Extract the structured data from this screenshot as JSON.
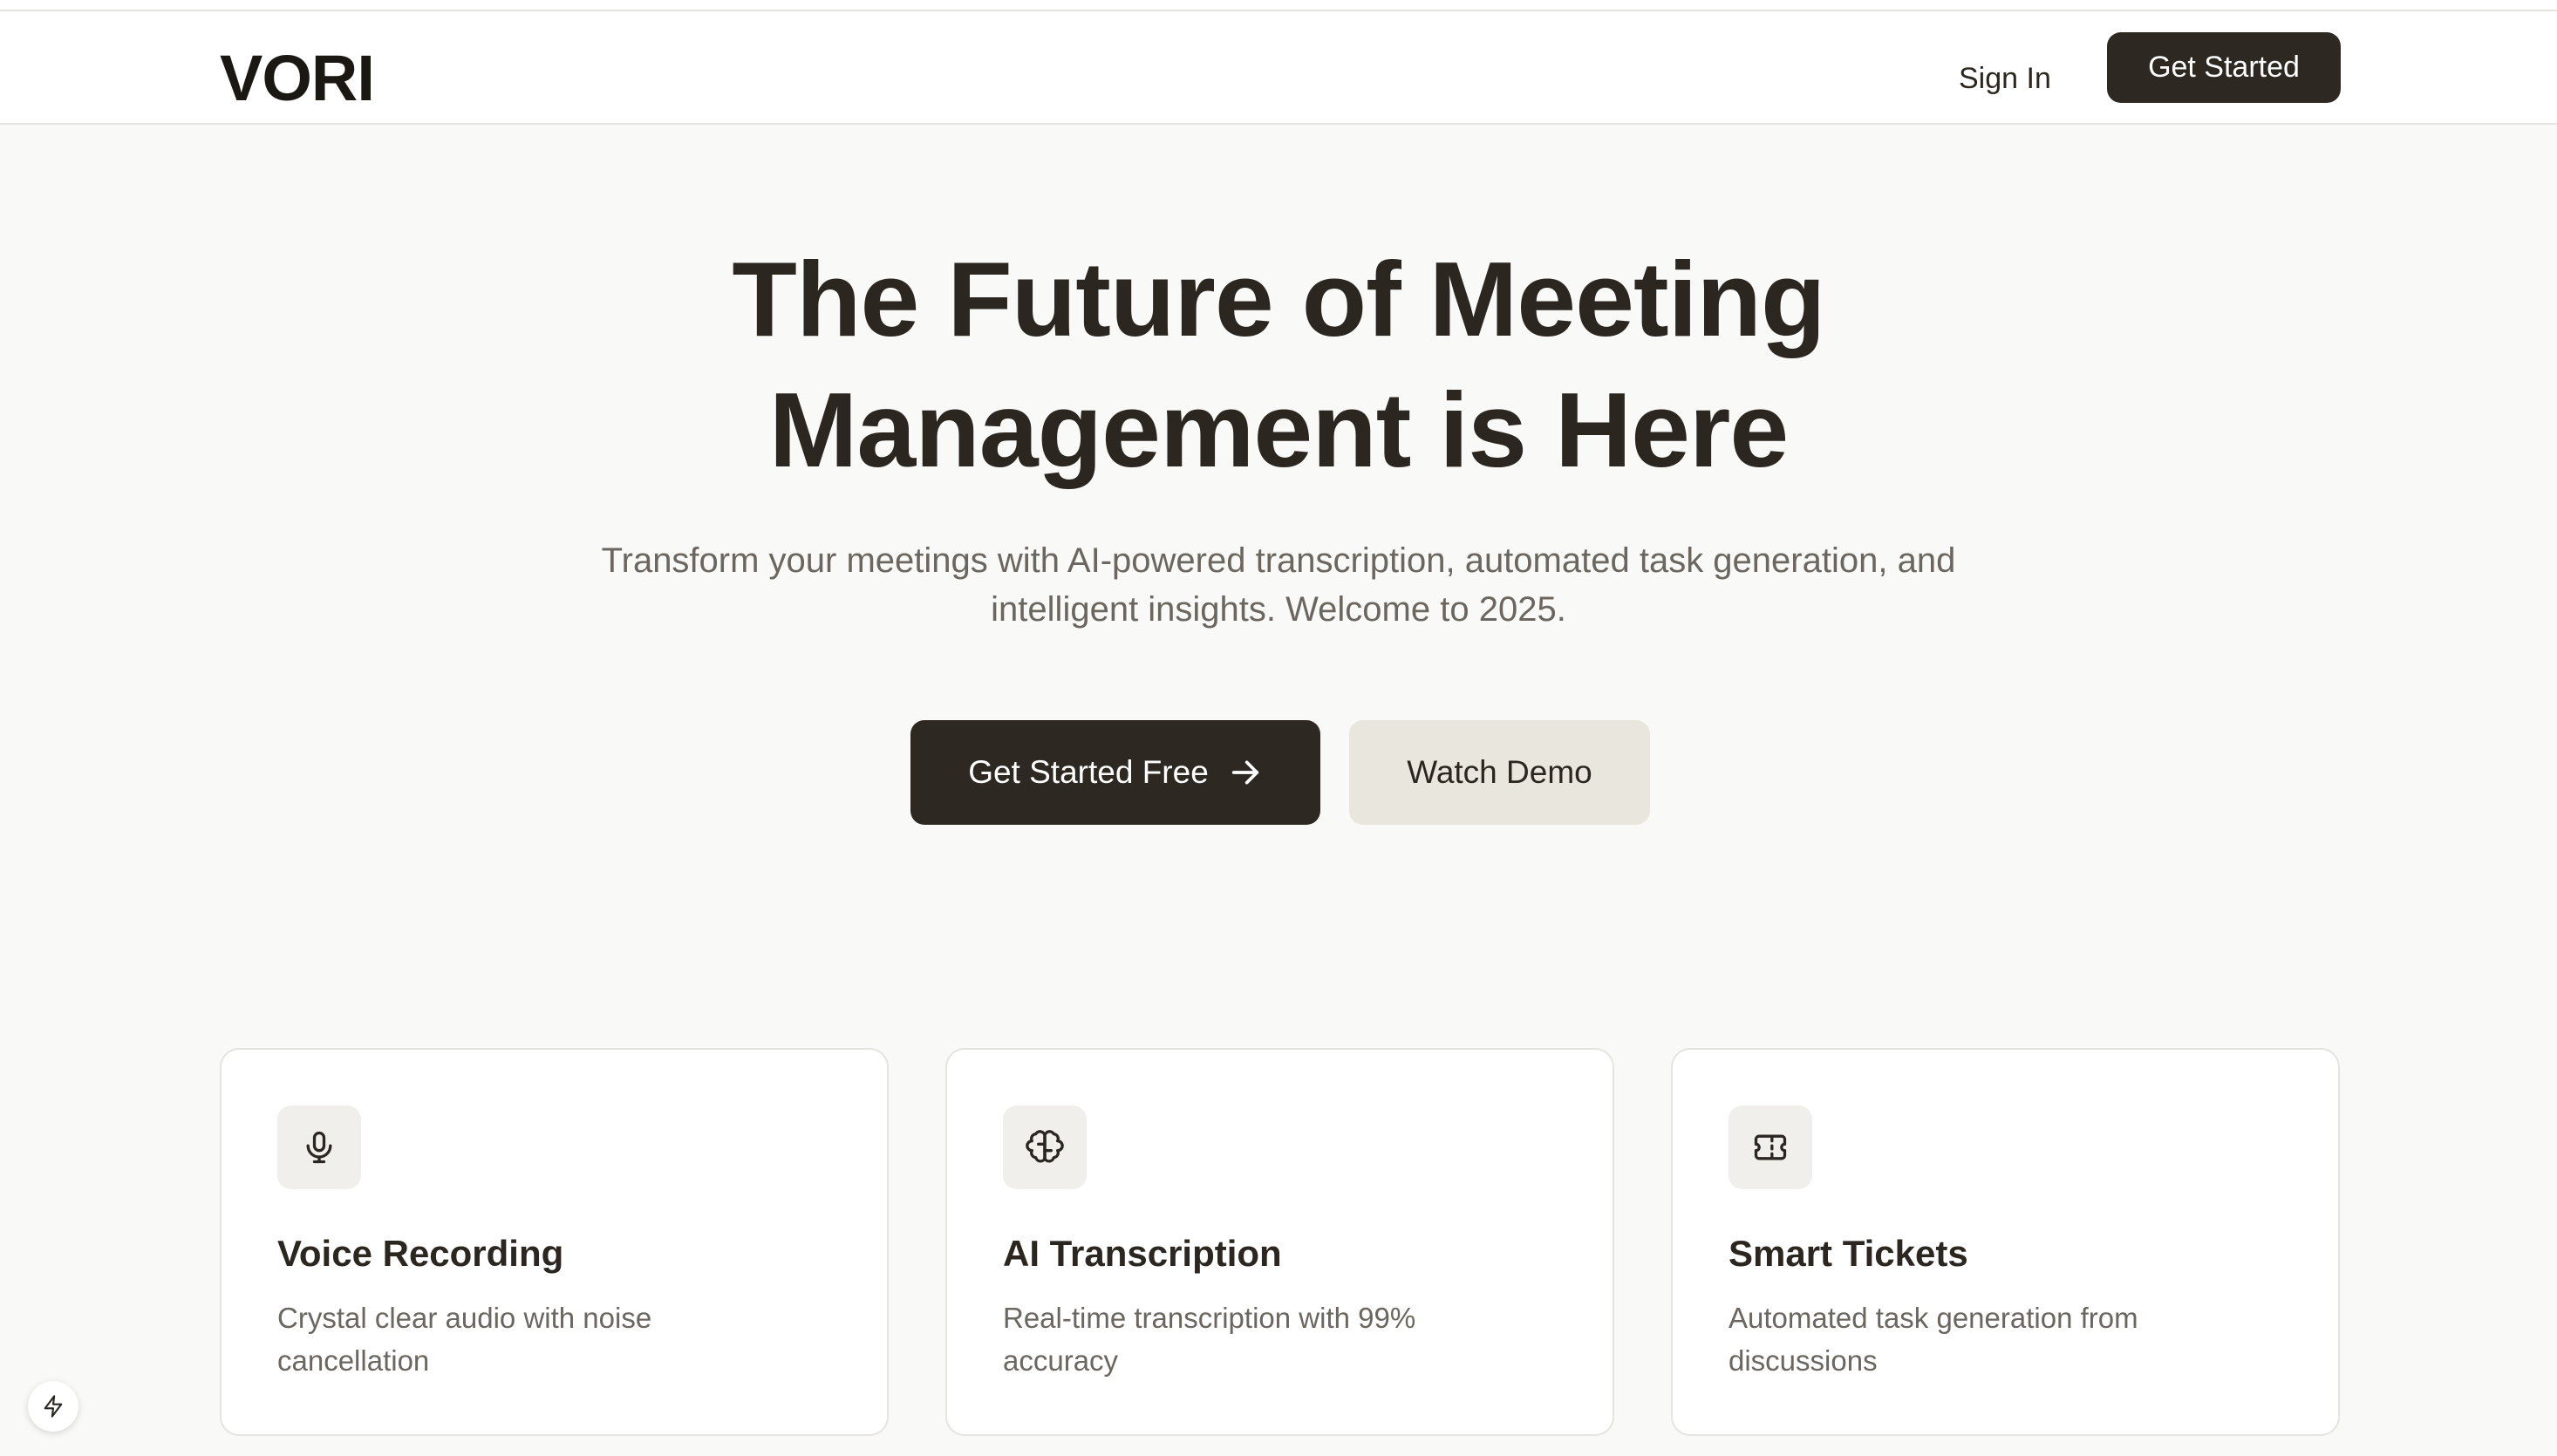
{
  "header": {
    "logo": "VORI",
    "sign_in": "Sign In",
    "get_started": "Get Started"
  },
  "hero": {
    "title_line1": "The Future of Meeting",
    "title_line2": "Management is Here",
    "subtitle_line1": "Transform your meetings with AI-powered transcription, automated task generation, and",
    "subtitle_line2": "intelligent insights. Welcome to 2025.",
    "primary_cta": "Get Started Free",
    "primary_cta_icon": "arrow-right-icon",
    "secondary_cta": "Watch Demo"
  },
  "features": [
    {
      "icon": "microphone-icon",
      "title": "Voice Recording",
      "desc_line1": "Crystal clear audio with noise",
      "desc_line2": "cancellation"
    },
    {
      "icon": "brain-icon",
      "title": "AI Transcription",
      "desc_line1": "Real-time transcription with 99%",
      "desc_line2": "accuracy"
    },
    {
      "icon": "ticket-icon",
      "title": "Smart Tickets",
      "desc_line1": "Automated task generation from",
      "desc_line2": "discussions"
    }
  ],
  "floating_button": {
    "icon": "lightning-icon"
  },
  "colors": {
    "background": "#f9f9f7",
    "primary": "#2d2822",
    "secondary_button": "#e9e6dd",
    "text_muted": "#6b665f"
  }
}
